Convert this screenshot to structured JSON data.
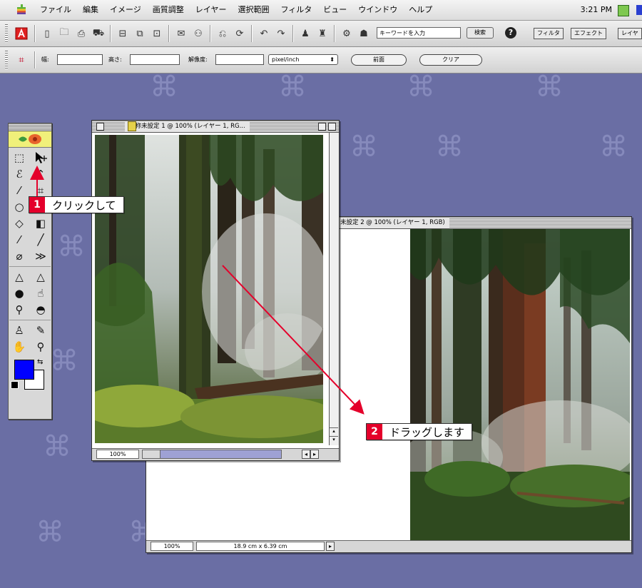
{
  "menubar": {
    "items": [
      "ファイル",
      "編集",
      "イメージ",
      "画質調整",
      "レイヤー",
      "選択範囲",
      "フィルタ",
      "ビュー",
      "ウインドウ",
      "ヘルプ"
    ],
    "clock": "3:21 PM"
  },
  "toolbar": {
    "search_placeholder": "キーワードを入力",
    "search_button": "検索",
    "palette_tabs": [
      "フィルタ",
      "エフェクト",
      "レイヤ"
    ]
  },
  "options_bar": {
    "width_label": "幅:",
    "height_label": "高さ:",
    "resolution_label": "解像度:",
    "unit_select": "pixel/inch",
    "front_button": "前面",
    "clear_button": "クリア"
  },
  "window1": {
    "title": "名称未設定 1 @ 100% (レイヤー 1, RG...",
    "zoom": "100%"
  },
  "window2": {
    "title": "未設定 2 @ 100% (レイヤー 1, RGB)",
    "zoom": "100%",
    "doc_size": "18.9 cm x 6.39 cm"
  },
  "callouts": [
    {
      "num": "1",
      "text": "クリックして"
    },
    {
      "num": "2",
      "text": "ドラッグします"
    }
  ],
  "colors": {
    "desktop": "#6a6ea4",
    "foreground": "#0000ff",
    "background": "#ffffff",
    "callout_red": "#e4002b"
  }
}
